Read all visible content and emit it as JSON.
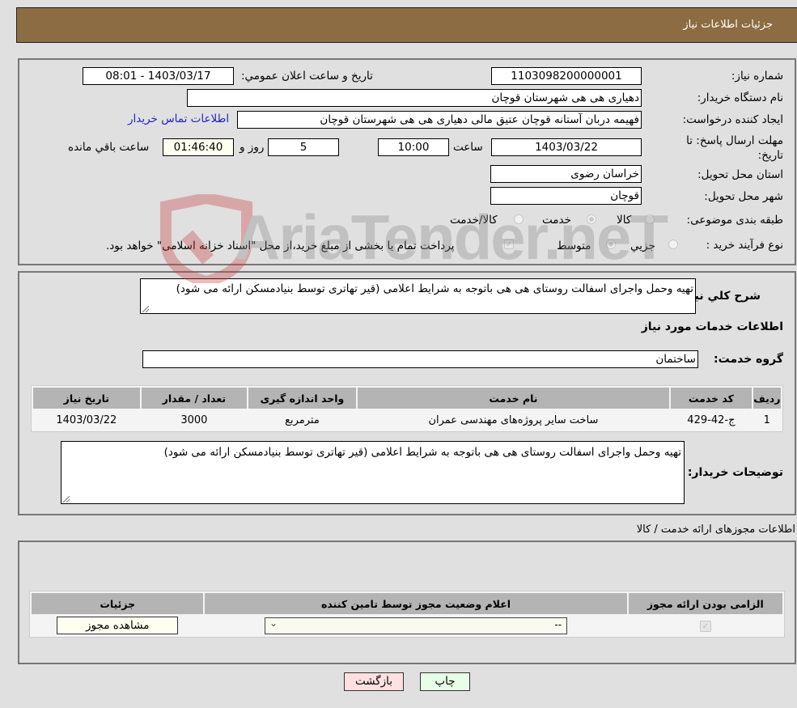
{
  "header": {
    "title": "جزئیات اطلاعات نیاز"
  },
  "details": {
    "need_number_label": "شماره نیاز:",
    "need_number": "1103098200000001",
    "announce_label": "تاریخ و ساعت اعلان عمومي:",
    "announce_value": "1403/03/17 - 08:01",
    "buyer_org_label": "نام دستگاه خریدار:",
    "buyer_org": "دهیاری هی هی  شهرستان قوچان",
    "creator_label": "ایجاد کننده درخواست:",
    "creator": "فهیمه دربان آستانه قوچان عتیق مالی دهیاری هی هی  شهرستان قوچان",
    "contact_link": "اطلاعات تماس خریدار",
    "deadline_label_line1": "مهلت ارسال پاسخ: تا",
    "deadline_label_line2": "تاریخ:",
    "deadline_date": "1403/03/22",
    "time_label": "ساعت",
    "deadline_time": "10:00",
    "days_value": "5",
    "days_label": "روز و",
    "remaining_value": "01:46:40",
    "remaining_label": "ساعت باقي مانده",
    "province_label": "استان محل تحویل:",
    "province": "خراسان رضوی",
    "city_label": "شهر محل تحویل:",
    "city": "قوچان",
    "category_label": "طبقه بندی موضوعی:",
    "category_options": [
      {
        "label": "کالا",
        "selected": false
      },
      {
        "label": "خدمت",
        "selected": true
      },
      {
        "label": "کالا/خدمت",
        "selected": false
      }
    ],
    "process_label": "نوع فرآیند خرید :",
    "process_options": [
      {
        "label": "جزيي",
        "selected": false
      },
      {
        "label": "متوسط",
        "selected": true
      }
    ],
    "treasury_checked": true,
    "treasury_text": "پرداخت تمام یا بخشی از مبلغ خرید،از محل \"اسناد خزانه اسلامی\" خواهد بود."
  },
  "description": {
    "label": "شرح کلي نیاز:",
    "text": "تهیه وحمل واجرای اسفالت روستای هی هی باتوجه به شرایط اعلامی (قیر تهاتری توسط بنیادمسکن ارائه می شود)"
  },
  "services": {
    "section_title": "اطلاعات خدمات مورد نیاز",
    "group_label": "گروه خدمت:",
    "group_value": "ساختمان",
    "columns": [
      "ردیف",
      "کد خدمت",
      "نام خدمت",
      "واحد اندازه گیری",
      "تعداد / مقدار",
      "تاریخ نیاز"
    ],
    "rows": [
      [
        "1",
        "ج-42-429",
        "ساخت سایر پروژه‌های مهندسی عمران",
        "مترمربع",
        "3000",
        "1403/03/22"
      ]
    ],
    "buyer_notes_label": "توضیحات خریدار:",
    "buyer_notes": "تهیه وحمل واجرای اسفالت روستای هی هی باتوجه به شرایط اعلامی (قیر تهاتری توسط بنیادمسکن ارائه می شود)"
  },
  "permits": {
    "section_title": "اطلاعات مجوزهای ارائه خدمت / کالا",
    "columns": [
      "الزامی بودن ارائه مجوز",
      "اعلام وضعیت مجوز توسط تامین کننده",
      "جزئیات"
    ],
    "row": {
      "required_checked": true,
      "status_selected": "--",
      "view_button": "مشاهده مجوز"
    }
  },
  "footer": {
    "print_button": "چاپ",
    "back_button": "بازگشت"
  },
  "watermark": {
    "text": "AriaTender.neT"
  }
}
